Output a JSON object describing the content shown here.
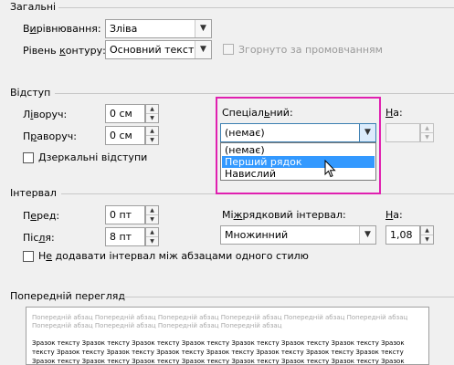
{
  "general": {
    "heading": "Загальні",
    "alignment_label_pre": "В",
    "alignment_label_u": "и",
    "alignment_label_post": "рівнювання:",
    "alignment_value": "Зліва",
    "outline_label_pre": "Рівень ",
    "outline_label_u": "к",
    "outline_label_post": "онтуру:",
    "outline_value": "Основний текст",
    "collapsed_label": "Згорнуто за промовчанням"
  },
  "indent": {
    "heading": "Відступ",
    "left_label_pre": "Л",
    "left_label_u": "і",
    "left_label_post": "воруч:",
    "left_value": "0 см",
    "right_label_pre": "П",
    "right_label_u": "р",
    "right_label_post": "аворуч:",
    "right_value": "0 см",
    "special_label_pre": "Спеціал",
    "special_label_u": "ь",
    "special_label_post": "ний:",
    "special_value": "(немає)",
    "by_label_u": "Н",
    "by_label_post": "а:",
    "by_value": "",
    "mirror_label_u": "Д",
    "mirror_label_post": "зеркальні відступи",
    "special_options": [
      "(немає)",
      "Перший рядок",
      "Навислий"
    ],
    "highlighted_option": "Перший рядок"
  },
  "spacing": {
    "heading": "Інтервал",
    "before_label_pre": "П",
    "before_label_u": "е",
    "before_label_post": "ред:",
    "before_value": "0 пт",
    "after_label_pre": "Піс",
    "after_label_u": "л",
    "after_label_post": "я:",
    "after_value": "8 пт",
    "line_label_pre": "Мі",
    "line_label_u": "ж",
    "line_label_post": "рядковий інтервал:",
    "line_value": "Множинний",
    "at_label_u": "Н",
    "at_label_post": "а:",
    "at_value": "1,08",
    "no_space_label_pre": "Н",
    "no_space_label_u": "е",
    "no_space_label_post": " додавати інтервал між абзацами одного стилю"
  },
  "preview": {
    "heading": "Попередній перегляд",
    "prev_paragraph": "Попередній абзац Попередній абзац Попередній абзац Попередній абзац Попередній абзац Попередній абзац Попередній абзац Попередній абзац Попередній абзац Попередній абзац",
    "sample_text": "Зразок тексту Зразок тексту Зразок тексту Зразок тексту Зразок тексту Зразок тексту Зразок тексту Зразок тексту Зразок тексту Зразок тексту Зразок тексту Зразок тексту Зразок тексту Зразок тексту Зразок тексту Зразок тексту Зразок тексту Зразок тексту Зразок тексту Зразок тексту Зразок тексту Зразок тексту Зразок тексту Зразок тексту Зразок тексту Зразок тексту Зразок тексту Зразок тексту"
  },
  "colors": {
    "highlight": "#3399ff",
    "annotation_box": "#e020b0"
  }
}
